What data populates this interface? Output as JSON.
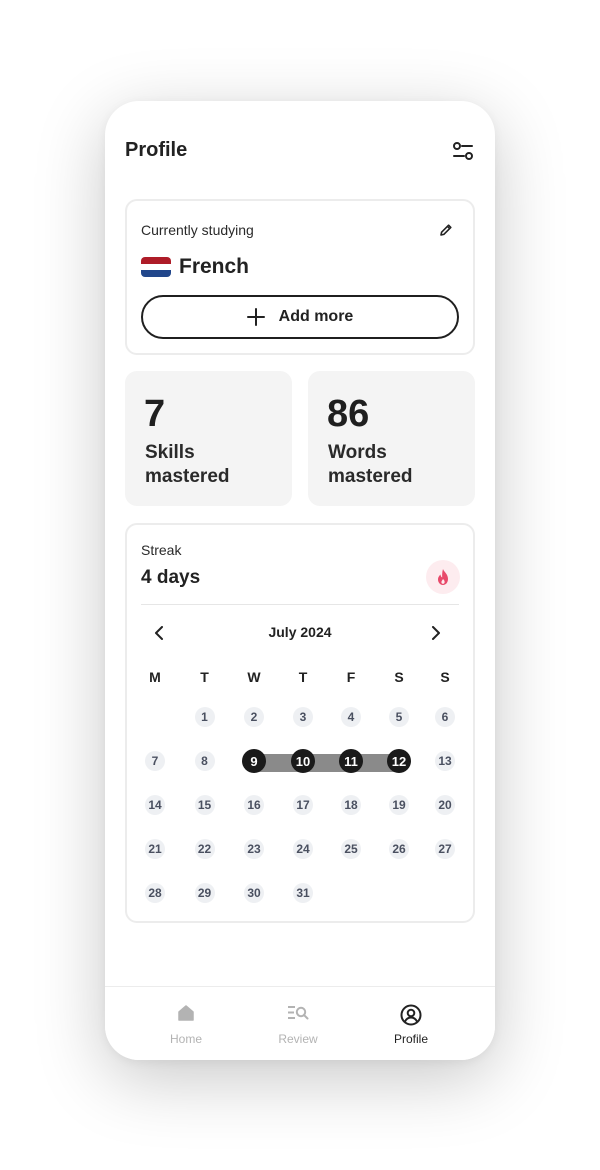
{
  "header": {
    "title": "Profile",
    "settings_icon": "sliders-icon"
  },
  "studying": {
    "label": "Currently studying",
    "language": "French",
    "flag_colors": [
      "#ae1c28",
      "#ffffff",
      "#21468b"
    ],
    "add_button": "Add more"
  },
  "stats": {
    "skills": {
      "value": "7",
      "label": "Skills mastered"
    },
    "words": {
      "value": "86",
      "label": "Words mastered"
    }
  },
  "streak": {
    "label": "Streak",
    "value": "4 days",
    "icon": "flame-icon",
    "accent_color": "#e8496a",
    "calendar": {
      "month": "July 2024",
      "weekdays": [
        "M",
        "T",
        "W",
        "T",
        "F",
        "S",
        "S"
      ],
      "first_weekday_index": 1,
      "days": [
        "1",
        "2",
        "3",
        "4",
        "5",
        "6",
        "7",
        "8",
        "9",
        "10",
        "11",
        "12",
        "13",
        "14",
        "15",
        "16",
        "17",
        "18",
        "19",
        "20",
        "21",
        "22",
        "23",
        "24",
        "25",
        "26",
        "27",
        "28",
        "29",
        "30",
        "31"
      ],
      "streak_days": [
        9,
        10,
        11,
        12
      ]
    }
  },
  "tabs": [
    {
      "label": "Home",
      "icon": "home-icon",
      "active": false
    },
    {
      "label": "Review",
      "icon": "review-search-icon",
      "active": false
    },
    {
      "label": "Profile",
      "icon": "profile-icon",
      "active": true
    }
  ]
}
